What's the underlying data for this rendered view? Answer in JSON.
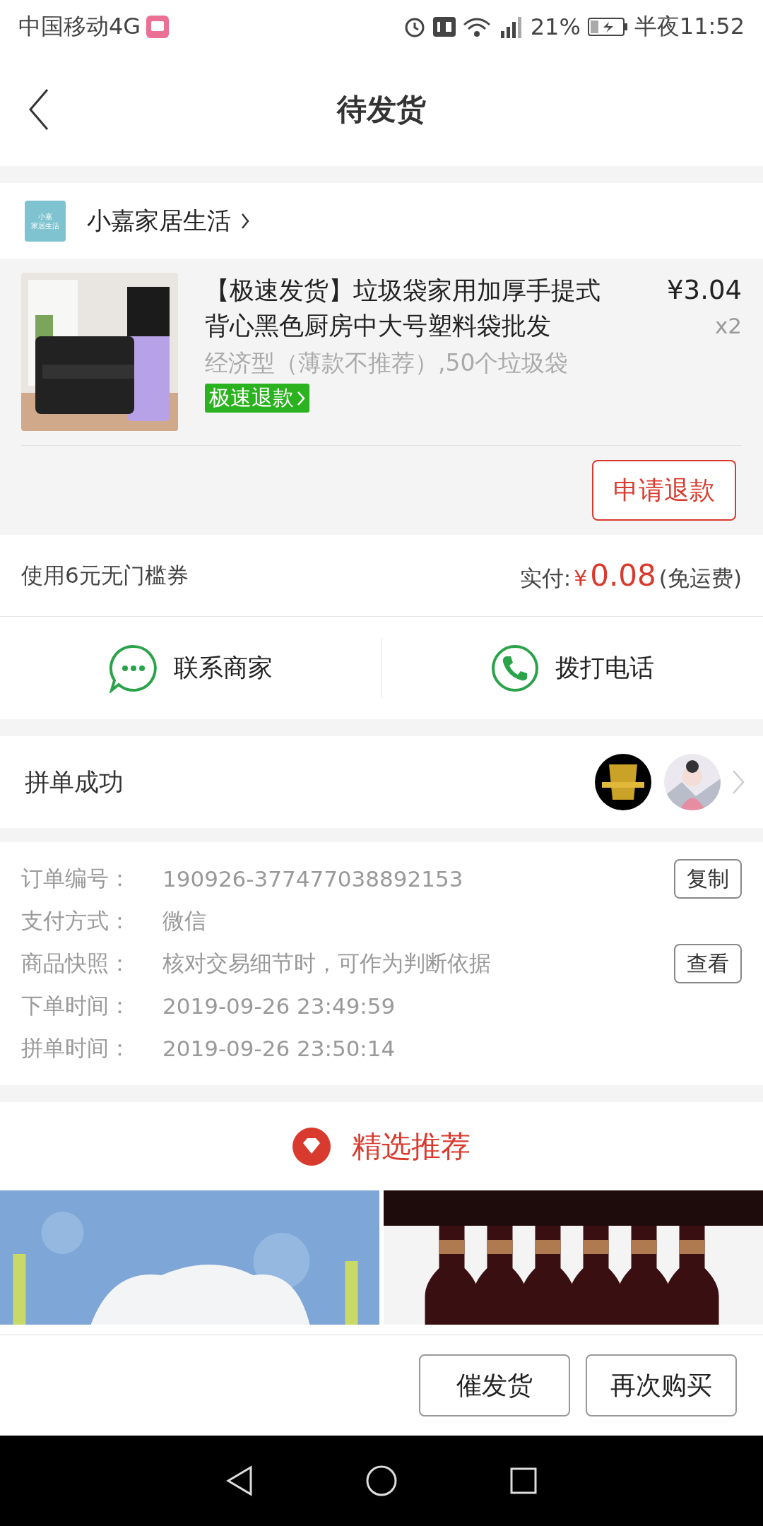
{
  "status_bar": {
    "carrier": "中国移动4G",
    "battery": "21%",
    "time": "半夜11:52"
  },
  "nav": {
    "title": "待发货"
  },
  "shop": {
    "logo_lines": [
      "小嘉",
      "家居生活"
    ],
    "name": "小嘉家居生活"
  },
  "product": {
    "title": "【极速发货】垃圾袋家用加厚手提式背心黑色厨房中大号塑料袋批发",
    "price": "¥3.04",
    "quantity": "x2",
    "spec": "经济型（薄款不推荐）,50个垃圾袋",
    "tag": "极速退款",
    "action": "申请退款"
  },
  "payment": {
    "coupon": "使用6元无门槛券",
    "paid_label": "实付:",
    "currency": "¥",
    "amount": "0.08",
    "shipping": "(免运费)"
  },
  "contacts": [
    {
      "kind": "chat",
      "label": "联系商家"
    },
    {
      "kind": "phone",
      "label": "拨打电话"
    }
  ],
  "group": {
    "status": "拼单成功"
  },
  "order_info": [
    {
      "label": "订单编号：",
      "value": "190926-377477038892153",
      "action": "复制"
    },
    {
      "label": "支付方式：",
      "value": "微信"
    },
    {
      "label": "商品快照：",
      "value": "核对交易细节时，可作为判断依据",
      "action": "查看"
    },
    {
      "label": "下单时间：",
      "value": "2019-09-26 23:49:59"
    },
    {
      "label": "拼单时间：",
      "value": "2019-09-26 23:50:14"
    }
  ],
  "recommend": {
    "title": "精选推荐"
  },
  "actions": [
    "催发货",
    "再次购买"
  ]
}
